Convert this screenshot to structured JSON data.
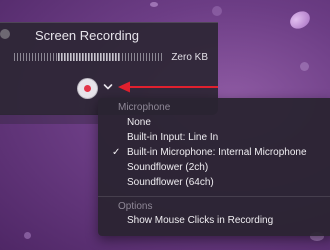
{
  "window": {
    "title": "Screen Recording",
    "file_size": "Zero KB"
  },
  "menu": {
    "microphone_header": "Microphone",
    "microphone_options": [
      {
        "label": "None",
        "checked": false
      },
      {
        "label": "Built-in Input: Line In",
        "checked": false
      },
      {
        "label": "Built-in Microphone: Internal Microphone",
        "checked": true
      },
      {
        "label": "Soundflower (2ch)",
        "checked": false
      },
      {
        "label": "Soundflower (64ch)",
        "checked": false
      }
    ],
    "options_header": "Options",
    "options_items": [
      {
        "label": "Show Mouse Clicks in Recording"
      }
    ],
    "checkmark": "✓"
  },
  "icons": {
    "record": "record-icon",
    "chevron": "chevron-down-icon",
    "arrow": "arrow-left-icon",
    "traffic": "close-dot-icon"
  },
  "colors": {
    "record_dot": "#e23448",
    "arrow": "#e0202e",
    "background": "#6c3d85"
  }
}
